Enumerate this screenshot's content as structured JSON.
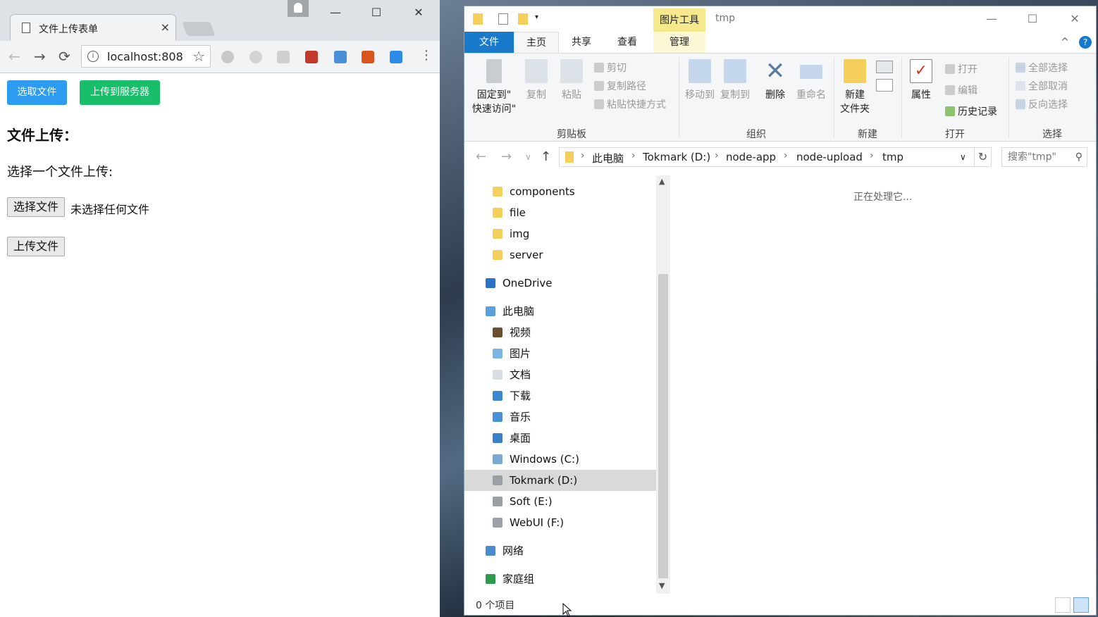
{
  "chrome": {
    "tab_title": "文件上传表单",
    "tab_close": "×",
    "window_min": "—",
    "window_max": "☐",
    "window_close": "✕",
    "back": "←",
    "forward": "→",
    "reload": "⟳",
    "address": "localhost:808",
    "info_glyph": "i",
    "star": "☆",
    "menu": "⋮"
  },
  "page": {
    "btn_select": "选取文件",
    "btn_upload_server": "上传到服务器",
    "heading": "文件上传：",
    "prompt": "选择一个文件上传:",
    "choose_file": "选择文件",
    "no_file": "未选择任何文件",
    "upload_file": "上传文件"
  },
  "explorer": {
    "context_tab": "图片工具",
    "title": "tmp",
    "window_min": "—",
    "window_max": "☐",
    "window_close": "✕",
    "collapse_ribbon": "^",
    "help": "?",
    "tabs": {
      "file": "文件",
      "home": "主页",
      "share": "共享",
      "view": "查看",
      "manage": "管理"
    },
    "ribbon": {
      "pin_line1": "固定到\"",
      "pin_line2": "快速访问\"",
      "copy": "复制",
      "paste": "粘贴",
      "cut": "剪切",
      "copy_path": "复制路径",
      "paste_shortcut": "粘贴快捷方式",
      "clipboard_group": "剪贴板",
      "move_to": "移动到",
      "copy_to": "复制到",
      "delete": "删除",
      "rename": "重命名",
      "organize_group": "组织",
      "new_folder_line1": "新建",
      "new_folder_line2": "文件夹",
      "new_group": "新建",
      "properties": "属性",
      "open": "打开",
      "edit": "编辑",
      "history": "历史记录",
      "open_group": "打开",
      "select_all": "全部选择",
      "select_none": "全部取消",
      "invert_selection": "反向选择",
      "select_group": "选择"
    },
    "address": {
      "back": "←",
      "forward": "→",
      "recent": "∨",
      "up": "↑",
      "crumbs": [
        "此电脑",
        "Tokmark (D:)",
        "node-app",
        "node-upload",
        "tmp"
      ],
      "dropdown": "∨",
      "refresh": "↻",
      "search_placeholder": "搜索\"tmp\"",
      "search_icon": "⚲"
    },
    "nav": [
      {
        "label": "components",
        "indent": 2,
        "icon": "folder-icon"
      },
      {
        "label": "file",
        "indent": 2,
        "icon": "folder-icon"
      },
      {
        "label": "img",
        "indent": 2,
        "icon": "folder-icon"
      },
      {
        "label": "server",
        "indent": 2,
        "icon": "folder-icon"
      },
      {
        "label": "OneDrive",
        "indent": 1,
        "icon": "onedrive-icon"
      },
      {
        "label": "此电脑",
        "indent": 1,
        "icon": "computer-icon"
      },
      {
        "label": "视频",
        "indent": 2,
        "icon": "videos-icon"
      },
      {
        "label": "图片",
        "indent": 2,
        "icon": "pictures-icon"
      },
      {
        "label": "文档",
        "indent": 2,
        "icon": "documents-icon"
      },
      {
        "label": "下载",
        "indent": 2,
        "icon": "downloads-icon"
      },
      {
        "label": "音乐",
        "indent": 2,
        "icon": "music-icon"
      },
      {
        "label": "桌面",
        "indent": 2,
        "icon": "desktop-icon"
      },
      {
        "label": "Windows (C:)",
        "indent": 2,
        "icon": "windows-drive-icon"
      },
      {
        "label": "Tokmark (D:)",
        "indent": 2,
        "icon": "drive-icon"
      },
      {
        "label": "Soft (E:)",
        "indent": 2,
        "icon": "drive-icon"
      },
      {
        "label": "WebUI (F:)",
        "indent": 2,
        "icon": "drive-icon"
      },
      {
        "label": "网络",
        "indent": 1,
        "icon": "network-icon"
      },
      {
        "label": "家庭组",
        "indent": 1,
        "icon": "homegroup-icon"
      }
    ],
    "processing": "正在处理它...",
    "status": "0 个项目",
    "scroll_up": "▲",
    "scroll_down": "▼"
  },
  "colors": {
    "accent_blue": "#2d9cf0",
    "accent_green": "#19be6b",
    "file_tab": "#1979ca",
    "context_tab": "#f6e98d"
  }
}
